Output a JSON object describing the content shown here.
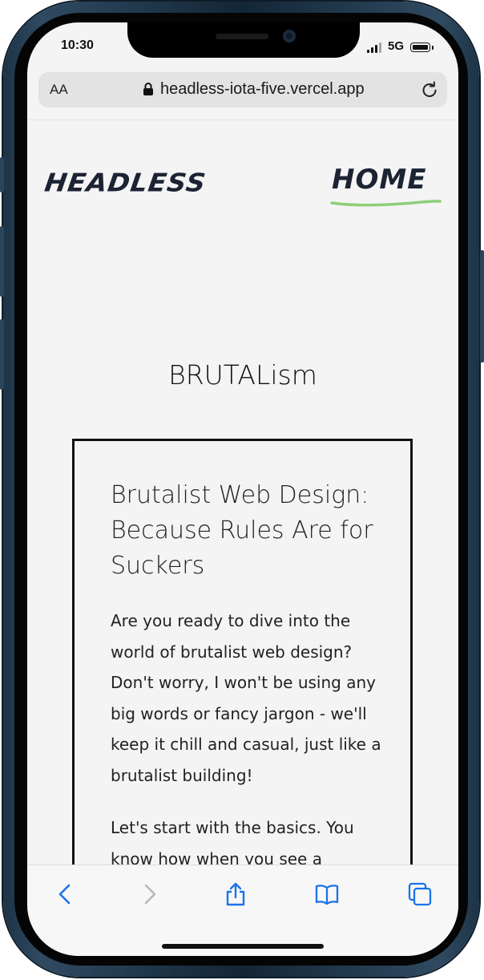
{
  "status": {
    "time": "10:30",
    "network": "5G"
  },
  "browser": {
    "text_size_label": "AA",
    "url": "headless-iota-five.vercel.app",
    "accent_color": "#1a73e8"
  },
  "site": {
    "logo": "HEADLESS",
    "nav": [
      {
        "label": "HOME",
        "underline_color": "#8ecf7a"
      }
    ]
  },
  "page": {
    "title": "BRUTALism",
    "post": {
      "title": "Brutalist Web Design: Because Rules Are for Suckers",
      "paragraphs": [
        "Are you ready to dive into the world of brutalist web design? Don't worry, I won't be using any big words or fancy jargon - we'll keep it chill and casual, just like a brutalist building!",
        "Let's start with the basics. You know how when you see a brutalist"
      ]
    }
  },
  "toolbar": {
    "icons": [
      "back-icon",
      "forward-icon",
      "share-icon",
      "bookmarks-icon",
      "tabs-icon"
    ]
  }
}
